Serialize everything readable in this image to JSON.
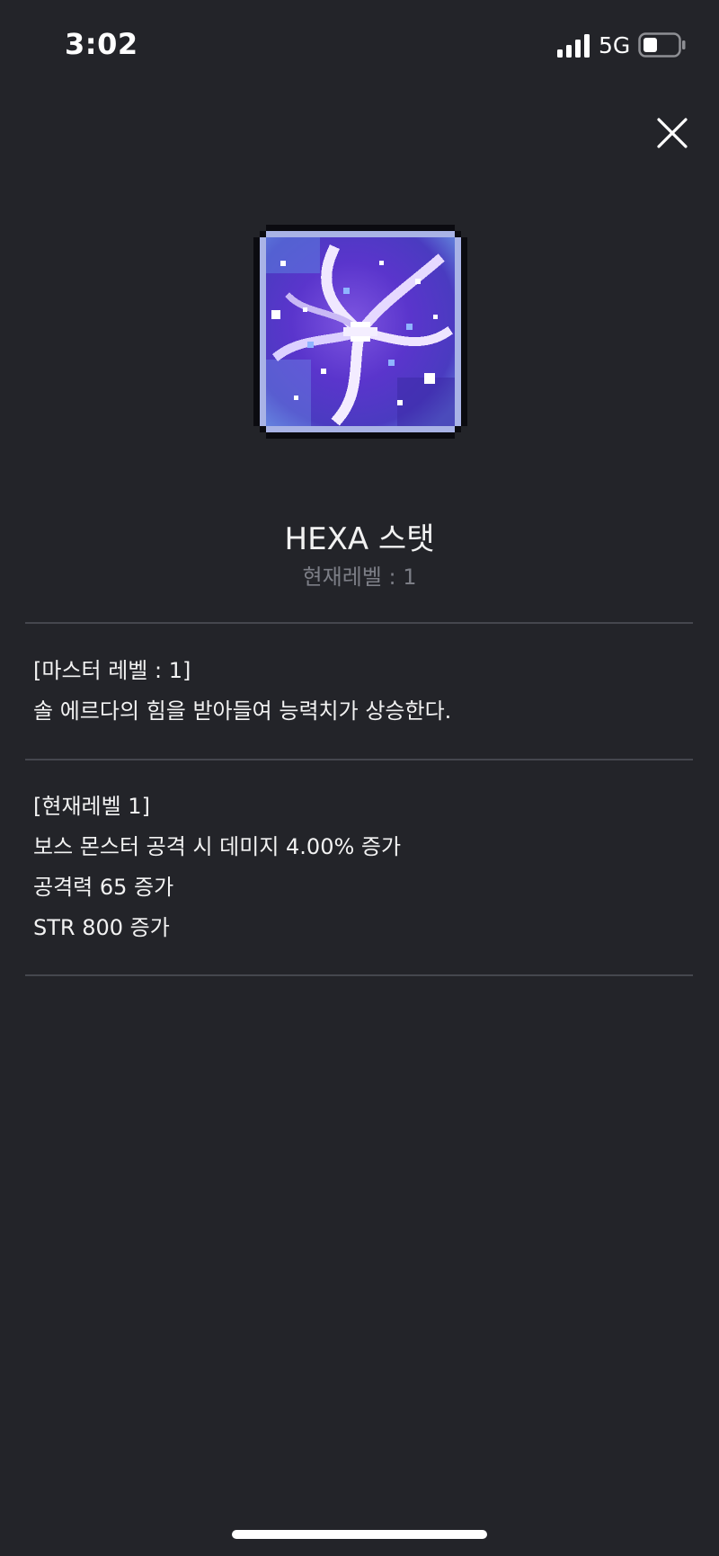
{
  "status_bar": {
    "time": "3:02",
    "network": "5G"
  },
  "skill": {
    "name": "HEXA 스탯",
    "current_level_label": "현재레벨 : 1",
    "icon": "hexa-stat-swirl-icon"
  },
  "master_section": {
    "header": "[마스터 레벨 : 1]",
    "description": "솔 에르다의 힘을 받아들여 능력치가 상승한다."
  },
  "current_section": {
    "header": "[현재레벨 1]",
    "effects": [
      "보스 몬스터 공격 시 데미지 4.00% 증가",
      "공격력 65 증가",
      "STR 800 증가"
    ]
  },
  "colors": {
    "background": "#232429",
    "text": "#f2f2f2",
    "muted": "#7c7e86",
    "divider": "#45474e"
  }
}
